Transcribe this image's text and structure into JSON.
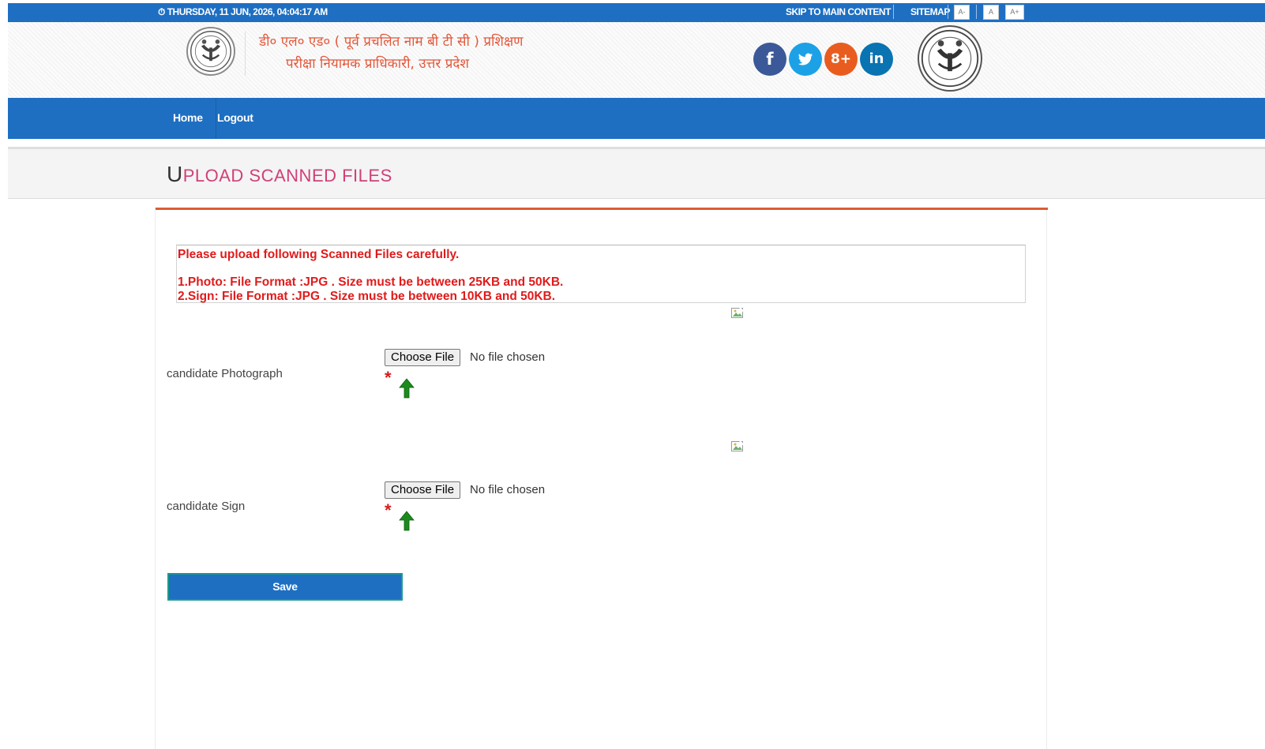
{
  "topbar": {
    "datetime": "⏱ THURSDAY, 11 JUN, 2026, 04:04:17 AM",
    "skip_link": "SKIP TO MAIN CONTENT",
    "sitemap_link": "SITEMAP",
    "font_smaller": "A-",
    "font_normal": "A",
    "font_larger": "A+"
  },
  "header": {
    "title_line1": "डी० एल० एड० ( पूर्व प्रचलित नाम बी टी सी ) प्रशिक्षण",
    "title_line2": "परीक्षा नियामक प्राधिकारी, उत्तर प्रदेश",
    "social": {
      "facebook": "f",
      "twitter": "t",
      "googleplus": "8+",
      "linkedin": "in"
    }
  },
  "nav": {
    "home": "Home",
    "logout": "Logout"
  },
  "page": {
    "title_first": "U",
    "title_rest": "PLOAD SCANNED FILES"
  },
  "notice": {
    "line1": "Please upload following Scanned Files carefully.",
    "line2": "1.Photo: File Format :JPG . Size must be between 25KB and 50KB.",
    "line3": "2.Sign: File Format :JPG . Size must be between 10KB and 50KB."
  },
  "fields": [
    {
      "label": "candidate Photograph",
      "button": "Choose File",
      "status": "No file chosen",
      "required": "*"
    },
    {
      "label": "candidate Sign",
      "button": "Choose File",
      "status": "No file chosen",
      "required": "*"
    }
  ],
  "actions": {
    "save": "Save"
  },
  "colors": {
    "primary_blue": "#1e6fc2",
    "title_pink": "#d04079",
    "notice_red": "#e01b1b",
    "accent_orange": "#de5c30",
    "facebook": "#3b5998",
    "twitter": "#1da1e6",
    "googleplus": "#e85d1f",
    "linkedin": "#0a73b1",
    "upload_green": "#1d8a1d"
  }
}
